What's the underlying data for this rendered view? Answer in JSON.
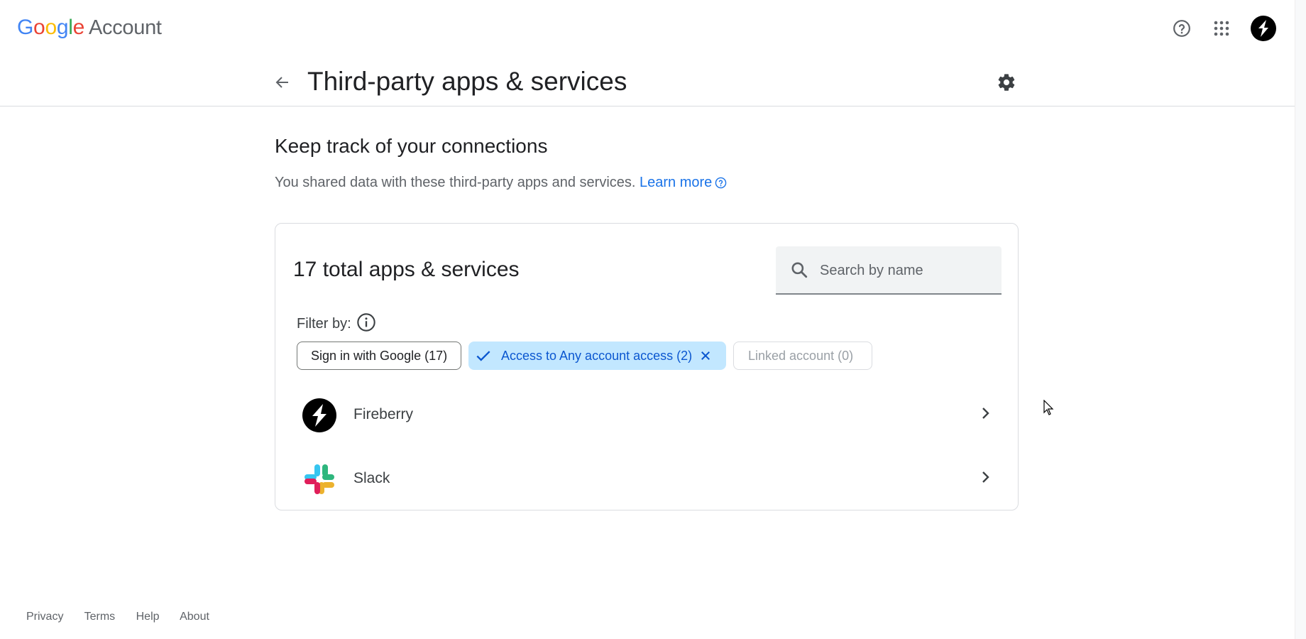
{
  "brand": {
    "logo_letters": [
      "G",
      "o",
      "o",
      "g",
      "l",
      "e"
    ],
    "product": "Account"
  },
  "header": {
    "help_icon": "help-circle-icon",
    "apps_icon": "apps-grid-icon",
    "avatar_icon": "fireberry-logo"
  },
  "page": {
    "title": "Third-party apps & services",
    "back_icon": "arrow-back-icon",
    "settings_icon": "gear-icon"
  },
  "section": {
    "title": "Keep track of your connections",
    "description": "You shared data with these third-party apps and services.",
    "learn_more": "Learn more"
  },
  "card": {
    "title": "17 total apps & services",
    "search_placeholder": "Search by name",
    "filter_label": "Filter by:",
    "chips": [
      {
        "label": "Sign in with Google (17)",
        "selected": false,
        "disabled": false
      },
      {
        "label": "Access to Any account access (2)",
        "selected": true,
        "disabled": false
      },
      {
        "label": "Linked account (0)",
        "selected": false,
        "disabled": true
      }
    ],
    "apps": [
      {
        "name": "Fireberry",
        "icon": "fireberry-logo"
      },
      {
        "name": "Slack",
        "icon": "slack-logo"
      }
    ]
  },
  "footer": {
    "links": [
      "Privacy",
      "Terms",
      "Help",
      "About"
    ]
  },
  "colors": {
    "accent": "#1a73e8",
    "chip_selected_bg": "#c2e7ff",
    "chip_selected_text": "#0b57d0"
  }
}
